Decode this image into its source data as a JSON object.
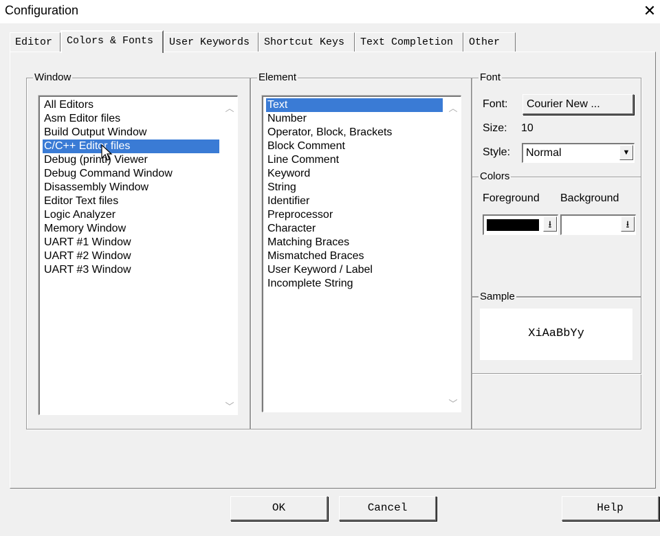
{
  "window": {
    "title": "Configuration",
    "close_glyph": "✕"
  },
  "tabs": [
    {
      "label": "Editor"
    },
    {
      "label": "Colors & Fonts"
    },
    {
      "label": "User Keywords"
    },
    {
      "label": "Shortcut Keys"
    },
    {
      "label": "Text Completion"
    },
    {
      "label": "Other"
    }
  ],
  "active_tab": "Colors & Fonts",
  "window_group": {
    "label": "Window",
    "items": [
      "All Editors",
      "Asm Editor files",
      "Build Output Window",
      "C/C++ Editor files",
      "Debug (printf) Viewer",
      "Debug Command Window",
      "Disassembly Window",
      "Editor Text files",
      "Logic Analyzer",
      "Memory Window",
      "UART #1 Window",
      "UART #2 Window",
      "UART #3 Window"
    ],
    "selected": "C/C++ Editor files"
  },
  "element_group": {
    "label": "Element",
    "items": [
      "Text",
      "Number",
      "Operator, Block, Brackets",
      "Block Comment",
      "Line Comment",
      "Keyword",
      "String",
      "Identifier",
      "Preprocessor",
      "Character",
      "Matching Braces",
      "Mismatched Braces",
      "User Keyword / Label",
      "Incomplete String"
    ],
    "selected": "Text"
  },
  "font_group": {
    "label": "Font",
    "font_label": "Font:",
    "font_button": "Courier New ...",
    "size_label": "Size:",
    "size_value": "10",
    "style_label": "Style:",
    "style_value": "Normal"
  },
  "colors_group": {
    "label": "Colors",
    "foreground_label": "Foreground",
    "background_label": "Background",
    "foreground_color": "#000000",
    "background_color": "#ffffff",
    "dropdown_glyph": "⭳"
  },
  "sample_group": {
    "label": "Sample",
    "text": "XiAaBbYy"
  },
  "buttons": {
    "ok": "OK",
    "cancel": "Cancel",
    "help": "Help"
  },
  "icons": {
    "scroll_up": "chevron-up-icon",
    "scroll_down": "chevron-down-icon",
    "combo_arrow": "triangle-down-icon",
    "mouse_cursor": "mouse-pointer-icon"
  }
}
